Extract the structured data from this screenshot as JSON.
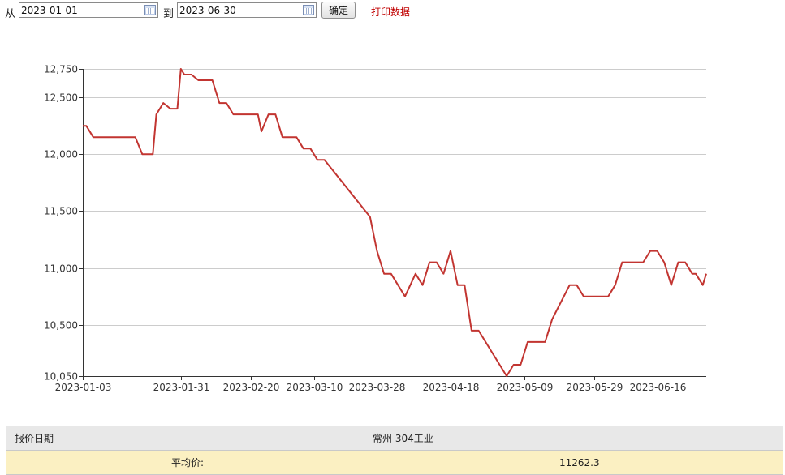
{
  "filter": {
    "from_label": "从",
    "from_value": "2023-01-01",
    "to_label": "到",
    "to_value": "2023-06-30",
    "confirm_label": "确定",
    "print_label": "打印数据",
    "print_color": "#c00000"
  },
  "chart_data": {
    "type": "line",
    "title": "",
    "xlabel": "",
    "ylabel": "",
    "ylim": [
      10050,
      12750
    ],
    "yticks": [
      10050,
      10500,
      11000,
      11500,
      12000,
      12500,
      12750
    ],
    "ytick_labels": [
      "10,050",
      "10,500",
      "11,000",
      "11,500",
      "12,000",
      "12,500",
      "12,750"
    ],
    "xlim": [
      "2023-01-03",
      "2023-06-30"
    ],
    "xtick_labels": [
      "2023-01-03",
      "2023-01-31",
      "2023-02-20",
      "2023-03-10",
      "2023-03-28",
      "2023-04-18",
      "2023-05-09",
      "2023-05-29",
      "2023-06-16"
    ],
    "grid": true,
    "line_color": "#c23531",
    "series": [
      {
        "values": [
          [
            "2023-01-03",
            12250
          ],
          [
            "2023-01-04",
            12250
          ],
          [
            "2023-01-06",
            12150
          ],
          [
            "2023-01-13",
            12150
          ],
          [
            "2023-01-18",
            12150
          ],
          [
            "2023-01-20",
            12000
          ],
          [
            "2023-01-23",
            12000
          ],
          [
            "2023-01-24",
            12350
          ],
          [
            "2023-01-26",
            12450
          ],
          [
            "2023-01-28",
            12400
          ],
          [
            "2023-01-30",
            12400
          ],
          [
            "2023-01-31",
            12750
          ],
          [
            "2023-02-01",
            12700
          ],
          [
            "2023-02-03",
            12700
          ],
          [
            "2023-02-05",
            12650
          ],
          [
            "2023-02-09",
            12650
          ],
          [
            "2023-02-11",
            12450
          ],
          [
            "2023-02-13",
            12450
          ],
          [
            "2023-02-15",
            12350
          ],
          [
            "2023-02-20",
            12350
          ],
          [
            "2023-02-22",
            12350
          ],
          [
            "2023-02-23",
            12200
          ],
          [
            "2023-02-25",
            12350
          ],
          [
            "2023-02-27",
            12350
          ],
          [
            "2023-03-01",
            12150
          ],
          [
            "2023-03-05",
            12150
          ],
          [
            "2023-03-07",
            12050
          ],
          [
            "2023-03-09",
            12050
          ],
          [
            "2023-03-11",
            11950
          ],
          [
            "2023-03-13",
            11950
          ],
          [
            "2023-03-26",
            11450
          ],
          [
            "2023-03-28",
            11150
          ],
          [
            "2023-03-30",
            10950
          ],
          [
            "2023-04-01",
            10950
          ],
          [
            "2023-04-05",
            10750
          ],
          [
            "2023-04-08",
            10950
          ],
          [
            "2023-04-10",
            10850
          ],
          [
            "2023-04-12",
            11050
          ],
          [
            "2023-04-14",
            11050
          ],
          [
            "2023-04-16",
            10950
          ],
          [
            "2023-04-18",
            11150
          ],
          [
            "2023-04-20",
            10850
          ],
          [
            "2023-04-22",
            10850
          ],
          [
            "2023-04-24",
            10450
          ],
          [
            "2023-04-26",
            10450
          ],
          [
            "2023-05-04",
            10050
          ],
          [
            "2023-05-06",
            10150
          ],
          [
            "2023-05-08",
            10150
          ],
          [
            "2023-05-10",
            10350
          ],
          [
            "2023-05-15",
            10350
          ],
          [
            "2023-05-17",
            10550
          ],
          [
            "2023-05-22",
            10850
          ],
          [
            "2023-05-24",
            10850
          ],
          [
            "2023-05-26",
            10750
          ],
          [
            "2023-06-02",
            10750
          ],
          [
            "2023-06-04",
            10850
          ],
          [
            "2023-06-06",
            11050
          ],
          [
            "2023-06-12",
            11050
          ],
          [
            "2023-06-14",
            11150
          ],
          [
            "2023-06-16",
            11150
          ],
          [
            "2023-06-18",
            11050
          ],
          [
            "2023-06-20",
            10850
          ],
          [
            "2023-06-22",
            11050
          ],
          [
            "2023-06-24",
            11050
          ],
          [
            "2023-06-26",
            10950
          ],
          [
            "2023-06-27",
            10950
          ],
          [
            "2023-06-29",
            10850
          ],
          [
            "2023-06-30",
            10950
          ]
        ]
      }
    ]
  },
  "table": {
    "col_date_header": "报价日期",
    "col_price_header": "常州 304工业",
    "avg_label": "平均价:",
    "avg_value": "11262.3"
  }
}
